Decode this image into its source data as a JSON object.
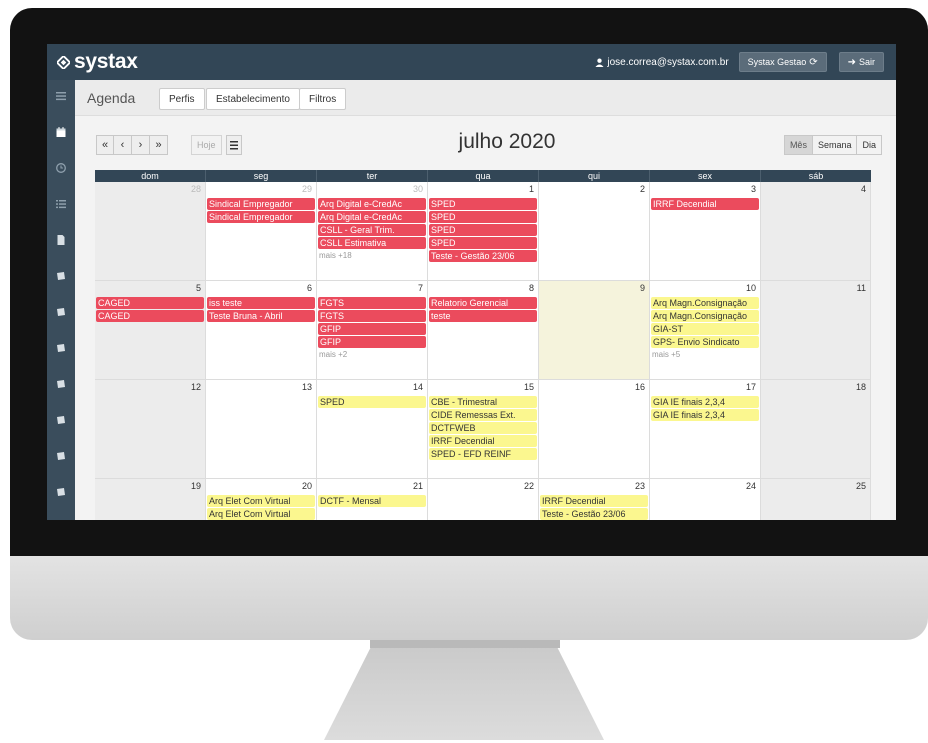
{
  "app": {
    "logo_text": "systax",
    "user_email": "jose.correa@systax.com.br",
    "gestao_label": "Systax Gestao",
    "sair_label": "Sair"
  },
  "subnav": {
    "title": "Agenda",
    "tabs": [
      "Perfis",
      "Estabelecimento",
      "Filtros"
    ]
  },
  "calendar": {
    "nav": [
      "«",
      "‹",
      "›",
      "»"
    ],
    "today_label": "Hoje",
    "title": "julho 2020",
    "views": [
      "Mês",
      "Semana",
      "Dia"
    ],
    "weekdays": [
      "dom",
      "seg",
      "ter",
      "qua",
      "qui",
      "sex",
      "sáb"
    ],
    "weeks": [
      [
        {
          "num": "28",
          "other": true,
          "events": []
        },
        {
          "num": "29",
          "other": true,
          "events": [
            {
              "t": "Sindical Empregador",
              "c": "red"
            },
            {
              "t": "Sindical Empregador",
              "c": "red"
            }
          ]
        },
        {
          "num": "30",
          "other": true,
          "events": [
            {
              "t": "Arq Digital e-CredAc",
              "c": "red"
            },
            {
              "t": "Arq Digital e-CredAc",
              "c": "red"
            },
            {
              "t": "CSLL - Geral Trim.",
              "c": "red"
            },
            {
              "t": "CSLL Estimativa",
              "c": "red"
            }
          ],
          "more": "mais +18"
        },
        {
          "num": "1",
          "events": [
            {
              "t": "SPED",
              "c": "red"
            },
            {
              "t": "SPED",
              "c": "red"
            },
            {
              "t": "SPED",
              "c": "red"
            },
            {
              "t": "SPED",
              "c": "red"
            },
            {
              "t": "Teste - Gestão 23/06",
              "c": "red"
            }
          ]
        },
        {
          "num": "2",
          "events": []
        },
        {
          "num": "3",
          "events": [
            {
              "t": "IRRF Decendial",
              "c": "red"
            }
          ]
        },
        {
          "num": "4",
          "events": []
        }
      ],
      [
        {
          "num": "5",
          "events": [
            {
              "t": "CAGED",
              "c": "red"
            },
            {
              "t": "CAGED",
              "c": "red"
            }
          ]
        },
        {
          "num": "6",
          "events": [
            {
              "t": "iss teste",
              "c": "red"
            },
            {
              "t": "Teste Bruna - Abril",
              "c": "red"
            }
          ]
        },
        {
          "num": "7",
          "events": [
            {
              "t": "FGTS",
              "c": "red"
            },
            {
              "t": "FGTS",
              "c": "red"
            },
            {
              "t": "GFIP",
              "c": "red"
            },
            {
              "t": "GFIP",
              "c": "red"
            }
          ],
          "more": "mais +2"
        },
        {
          "num": "8",
          "events": [
            {
              "t": "Relatorio Gerencial",
              "c": "red"
            },
            {
              "t": "teste",
              "c": "red"
            }
          ]
        },
        {
          "num": "9",
          "today": true,
          "events": []
        },
        {
          "num": "10",
          "events": [
            {
              "t": "Arq Magn.Consignação",
              "c": "yellow"
            },
            {
              "t": "Arq Magn.Consignação",
              "c": "yellow"
            },
            {
              "t": "GIA-ST",
              "c": "yellow"
            },
            {
              "t": "GPS- Envio Sindicato",
              "c": "yellow"
            }
          ],
          "more": "mais +5"
        },
        {
          "num": "11",
          "events": []
        }
      ],
      [
        {
          "num": "12",
          "events": []
        },
        {
          "num": "13",
          "events": []
        },
        {
          "num": "14",
          "events": [
            {
              "t": "SPED",
              "c": "yellow"
            }
          ]
        },
        {
          "num": "15",
          "events": [
            {
              "t": "CBE - Trimestral",
              "c": "yellow"
            },
            {
              "t": "CIDE Remessas Ext.",
              "c": "yellow"
            },
            {
              "t": "DCTFWEB",
              "c": "yellow"
            },
            {
              "t": "IRRF Decendial",
              "c": "yellow"
            },
            {
              "t": "SPED - EFD REINF",
              "c": "yellow"
            }
          ]
        },
        {
          "num": "16",
          "events": []
        },
        {
          "num": "17",
          "events": [
            {
              "t": "GIA IE finais 2,3,4",
              "c": "yellow"
            },
            {
              "t": "GIA IE finais 2,3,4",
              "c": "yellow"
            }
          ]
        },
        {
          "num": "18",
          "events": []
        }
      ],
      [
        {
          "num": "19",
          "events": []
        },
        {
          "num": "20",
          "events": [
            {
              "t": "Arq Elet Com Virtual",
              "c": "yellow"
            },
            {
              "t": "Arq Elet Com Virtual",
              "c": "yellow"
            }
          ]
        },
        {
          "num": "21",
          "events": [
            {
              "t": "DCTF - Mensal",
              "c": "yellow"
            }
          ]
        },
        {
          "num": "22",
          "events": []
        },
        {
          "num": "23",
          "events": [
            {
              "t": "IRRF Decendial",
              "c": "yellow"
            },
            {
              "t": "Teste - Gestão 23/06",
              "c": "yellow"
            }
          ]
        },
        {
          "num": "24",
          "events": []
        },
        {
          "num": "25",
          "events": []
        }
      ]
    ]
  }
}
